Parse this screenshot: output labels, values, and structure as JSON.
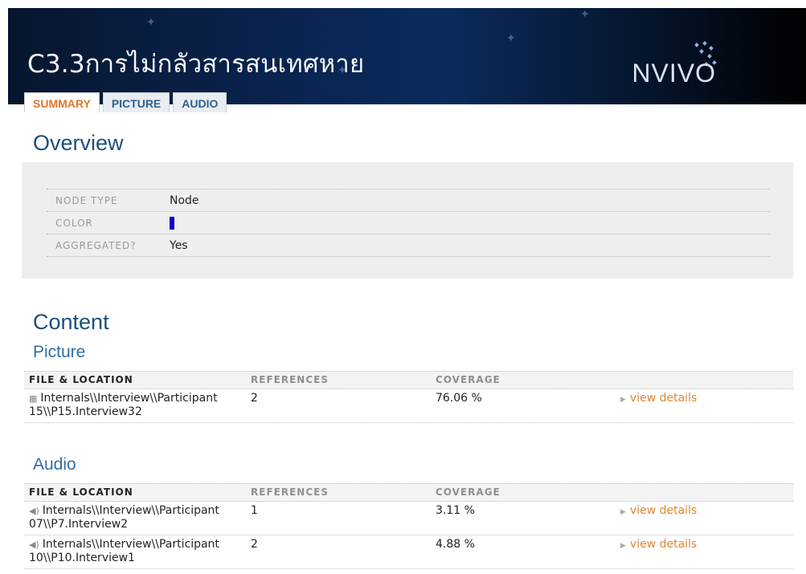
{
  "header": {
    "title": "C3.3การไม่กลัวสารสนเทศหาย",
    "logo": "NVIVO"
  },
  "tabs": [
    {
      "label": "SUMMARY",
      "active": true
    },
    {
      "label": "PICTURE",
      "active": false
    },
    {
      "label": "AUDIO",
      "active": false
    }
  ],
  "overview": {
    "heading": "Overview",
    "rows": [
      {
        "label": "NODE TYPE",
        "value": "Node"
      },
      {
        "label": "COLOR",
        "value": "",
        "color": "#0000cc"
      },
      {
        "label": "AGGREGATED?",
        "value": "Yes"
      }
    ]
  },
  "content": {
    "heading": "Content",
    "columns": {
      "file": "FILE & LOCATION",
      "references": "REFERENCES",
      "coverage": "COVERAGE"
    },
    "picture": {
      "heading": "Picture",
      "rows": [
        {
          "icon": "picture-file-icon",
          "file_line1": "Internals\\\\Interview\\\\Participant",
          "file_line2": "15\\\\P15.Interview32",
          "references": "2",
          "coverage": "76.06 %",
          "link": "view details"
        }
      ]
    },
    "audio": {
      "heading": "Audio",
      "rows": [
        {
          "icon": "audio-file-icon",
          "file_line1": "Internals\\\\Interview\\\\Participant",
          "file_line2": "07\\\\P7.Interview2",
          "references": "1",
          "coverage": "3.11 %",
          "link": "view details"
        },
        {
          "icon": "audio-file-icon",
          "file_line1": "Internals\\\\Interview\\\\Participant",
          "file_line2": "10\\\\P10.Interview1",
          "references": "2",
          "coverage": "4.88 %",
          "link": "view details"
        }
      ]
    }
  }
}
